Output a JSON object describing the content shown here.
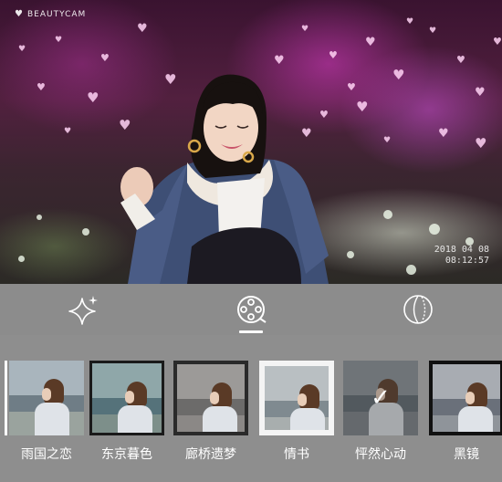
{
  "watermark": {
    "icon": "heart-icon",
    "text": "BEAUTYCAM"
  },
  "photo": {
    "timestamp_line1": "2018 04 08",
    "timestamp_line2": "08:12:57"
  },
  "toolbar": {
    "tools": [
      {
        "name": "sparkle-icon"
      },
      {
        "name": "film-reel-icon",
        "selected": true
      },
      {
        "name": "lens-icon"
      }
    ]
  },
  "filters": [
    {
      "label": "雨国之恋"
    },
    {
      "label": "东京暮色"
    },
    {
      "label": "廊桥遗梦"
    },
    {
      "label": "情书"
    },
    {
      "label": "怦然心动",
      "selected": true
    },
    {
      "label": "黑镜"
    }
  ],
  "colors": {
    "panel": "#8c8c8c",
    "text": "#ffffff",
    "accent_photo": "#d24fc4"
  }
}
